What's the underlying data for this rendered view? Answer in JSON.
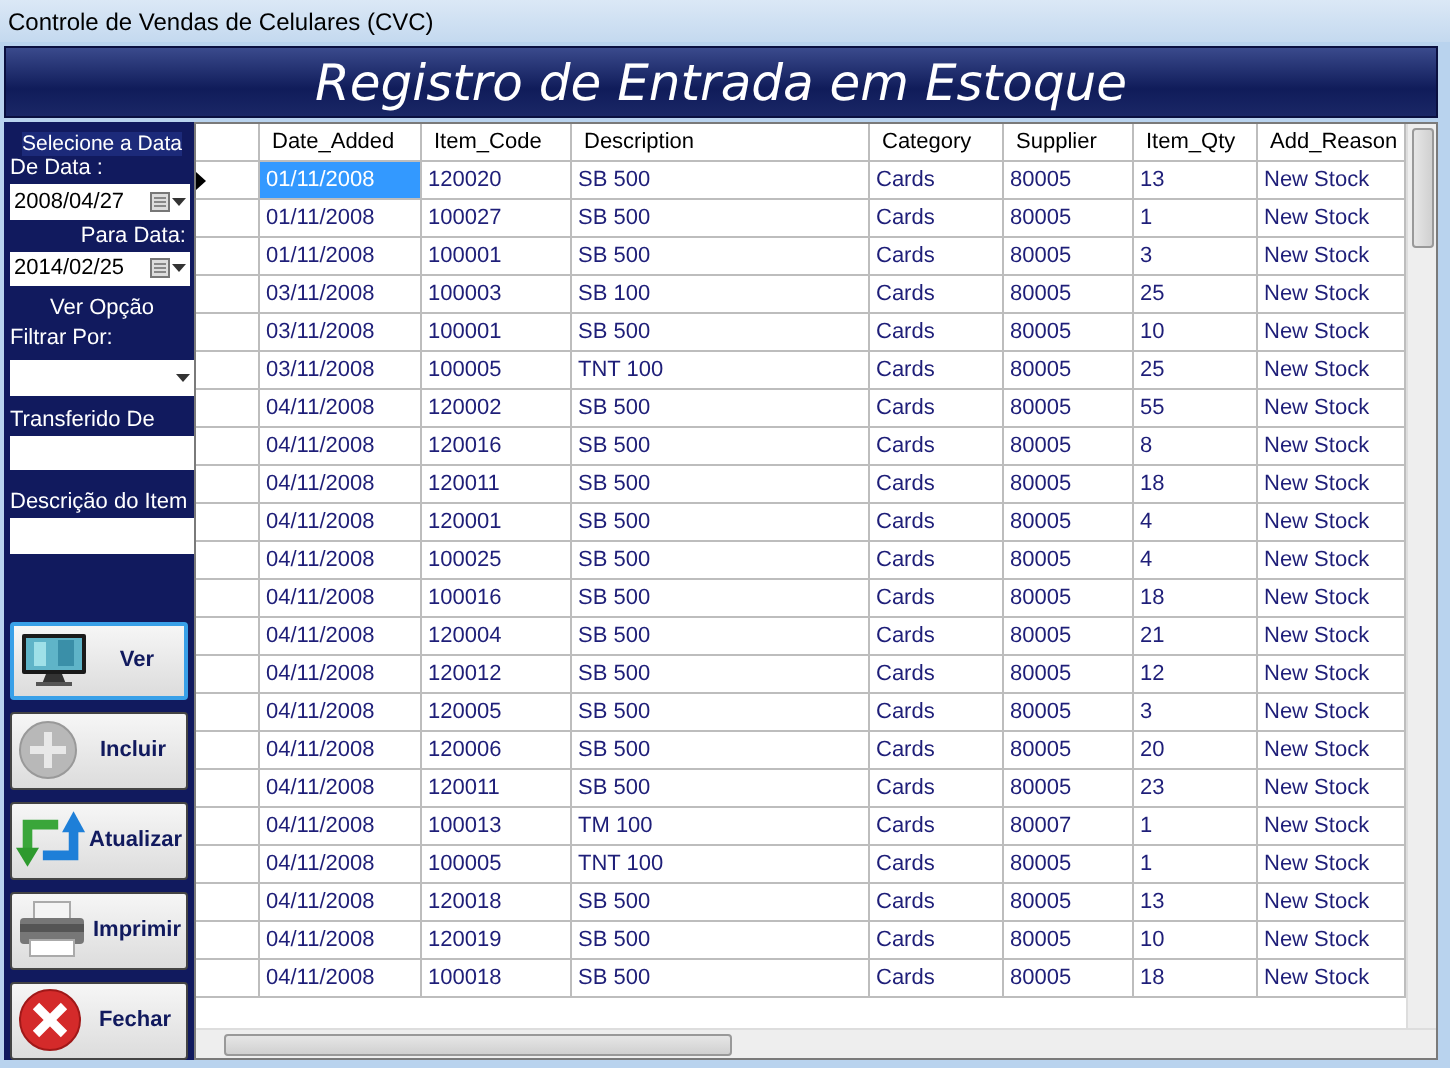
{
  "window": {
    "title": "Controle de Vendas de Celulares (CVC)"
  },
  "banner": {
    "title": "Registro de Entrada em Estoque"
  },
  "filters": {
    "heading": "Selecione a Data",
    "from_label": "De Data :",
    "from_value": "2008/04/27",
    "to_label": "Para Data:",
    "to_value": "2014/02/25",
    "view_heading": "Ver Opção",
    "filter_label": "Filtrar Por:",
    "transfer_label": "Transferido De",
    "description_label": "Descrição do Item"
  },
  "buttons": [
    {
      "label": "Ver",
      "kind": "monitor",
      "focused": true
    },
    {
      "label": "Incluir",
      "kind": "plus",
      "focused": false
    },
    {
      "label": "Atualizar",
      "kind": "refresh",
      "focused": false
    },
    {
      "label": "Imprimir",
      "kind": "printer",
      "focused": false
    },
    {
      "label": "Fechar",
      "kind": "close",
      "focused": false
    }
  ],
  "table": {
    "columns": [
      "Date_Added",
      "Item_Code",
      "Description",
      "Category",
      "Supplier",
      "Item_Qty",
      "Add_Reason"
    ],
    "rows": [
      {
        "selected": true,
        "current": true,
        "cells": [
          "01/11/2008",
          "120020",
          "SB 500",
          "Cards",
          "80005",
          "13",
          "New Stock"
        ]
      },
      {
        "selected": false,
        "current": false,
        "cells": [
          "01/11/2008",
          "100027",
          "SB 500",
          "Cards",
          "80005",
          "1",
          "New Stock"
        ]
      },
      {
        "selected": false,
        "current": false,
        "cells": [
          "01/11/2008",
          "100001",
          "SB 500",
          "Cards",
          "80005",
          "3",
          "New Stock"
        ]
      },
      {
        "selected": false,
        "current": false,
        "cells": [
          "03/11/2008",
          "100003",
          "SB 100",
          "Cards",
          "80005",
          "25",
          "New Stock"
        ]
      },
      {
        "selected": false,
        "current": false,
        "cells": [
          "03/11/2008",
          "100001",
          "SB 500",
          "Cards",
          "80005",
          "10",
          "New Stock"
        ]
      },
      {
        "selected": false,
        "current": false,
        "cells": [
          "03/11/2008",
          "100005",
          "TNT 100",
          "Cards",
          "80005",
          "25",
          "New Stock"
        ]
      },
      {
        "selected": false,
        "current": false,
        "cells": [
          "04/11/2008",
          "120002",
          "SB 500",
          "Cards",
          "80005",
          "55",
          "New Stock"
        ]
      },
      {
        "selected": false,
        "current": false,
        "cells": [
          "04/11/2008",
          "120016",
          "SB 500",
          "Cards",
          "80005",
          "8",
          "New Stock"
        ]
      },
      {
        "selected": false,
        "current": false,
        "cells": [
          "04/11/2008",
          "120011",
          "SB 500",
          "Cards",
          "80005",
          "18",
          "New Stock"
        ]
      },
      {
        "selected": false,
        "current": false,
        "cells": [
          "04/11/2008",
          "120001",
          "SB 500",
          "Cards",
          "80005",
          "4",
          "New Stock"
        ]
      },
      {
        "selected": false,
        "current": false,
        "cells": [
          "04/11/2008",
          "100025",
          "SB 500",
          "Cards",
          "80005",
          "4",
          "New Stock"
        ]
      },
      {
        "selected": false,
        "current": false,
        "cells": [
          "04/11/2008",
          "100016",
          "SB 500",
          "Cards",
          "80005",
          "18",
          "New Stock"
        ]
      },
      {
        "selected": false,
        "current": false,
        "cells": [
          "04/11/2008",
          "120004",
          "SB 500",
          "Cards",
          "80005",
          "21",
          "New Stock"
        ]
      },
      {
        "selected": false,
        "current": false,
        "cells": [
          "04/11/2008",
          "120012",
          "SB 500",
          "Cards",
          "80005",
          "12",
          "New Stock"
        ]
      },
      {
        "selected": false,
        "current": false,
        "cells": [
          "04/11/2008",
          "120005",
          "SB 500",
          "Cards",
          "80005",
          "3",
          "New Stock"
        ]
      },
      {
        "selected": false,
        "current": false,
        "cells": [
          "04/11/2008",
          "120006",
          "SB 500",
          "Cards",
          "80005",
          "20",
          "New Stock"
        ]
      },
      {
        "selected": false,
        "current": false,
        "cells": [
          "04/11/2008",
          "120011",
          "SB 500",
          "Cards",
          "80005",
          "23",
          "New Stock"
        ]
      },
      {
        "selected": false,
        "current": false,
        "cells": [
          "04/11/2008",
          "100013",
          "TM 100",
          "Cards",
          "80007",
          "1",
          "New Stock"
        ]
      },
      {
        "selected": false,
        "current": false,
        "cells": [
          "04/11/2008",
          "100005",
          "TNT 100",
          "Cards",
          "80005",
          "1",
          "New Stock"
        ]
      },
      {
        "selected": false,
        "current": false,
        "cells": [
          "04/11/2008",
          "120018",
          "SB 500",
          "Cards",
          "80005",
          "13",
          "New Stock"
        ]
      },
      {
        "selected": false,
        "current": false,
        "cells": [
          "04/11/2008",
          "120019",
          "SB 500",
          "Cards",
          "80005",
          "10",
          "New Stock"
        ]
      },
      {
        "selected": false,
        "current": false,
        "cells": [
          "04/11/2008",
          "100018",
          "SB 500",
          "Cards",
          "80005",
          "18",
          "New Stock"
        ]
      }
    ]
  }
}
